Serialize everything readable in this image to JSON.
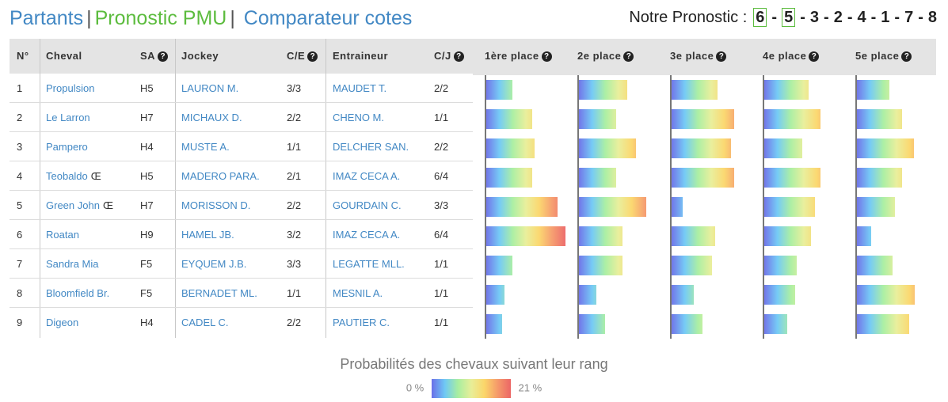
{
  "nav": {
    "partants": "Partants",
    "sep1": "|",
    "pronostic": "Pronostic PMU",
    "sep2": "|",
    "comparateur": "Comparateur cotes"
  },
  "pronostic": {
    "label": "Notre Pronostic :",
    "sequence": [
      "6",
      "5",
      "3",
      "2",
      "4",
      "1",
      "7",
      "8"
    ],
    "highlighted": [
      "6",
      "5"
    ],
    "separator": "-"
  },
  "table": {
    "headers": {
      "num": "N°",
      "cheval": "Cheval",
      "sa": "SA",
      "jockey": "Jockey",
      "ce": "C/E",
      "entraineur": "Entraineur",
      "cj": "C/J",
      "help_icon": "question-circle-icon"
    },
    "rows": [
      {
        "num": "1",
        "cheval": "Propulsion",
        "mark": "",
        "sa": "H5",
        "jockey": "LAURON M.",
        "ce": "3/3",
        "entraineur": "MAUDET T.",
        "cj": "2/2"
      },
      {
        "num": "2",
        "cheval": "Le Larron",
        "mark": "",
        "sa": "H7",
        "jockey": "MICHAUX D.",
        "ce": "2/2",
        "entraineur": "CHENO M.",
        "cj": "1/1"
      },
      {
        "num": "3",
        "cheval": "Pampero",
        "mark": "",
        "sa": "H4",
        "jockey": "MUSTE A.",
        "ce": "1/1",
        "entraineur": "DELCHER SAN.",
        "cj": "2/2"
      },
      {
        "num": "4",
        "cheval": "Teobaldo",
        "mark": "Œ",
        "sa": "H5",
        "jockey": "MADERO PARA.",
        "ce": "2/1",
        "entraineur": "IMAZ CECA A.",
        "cj": "6/4"
      },
      {
        "num": "5",
        "cheval": "Green John",
        "mark": "Œ",
        "sa": "H7",
        "jockey": "MORISSON D.",
        "ce": "2/2",
        "entraineur": "GOURDAIN C.",
        "cj": "3/3"
      },
      {
        "num": "6",
        "cheval": "Roatan",
        "mark": "",
        "sa": "H9",
        "jockey": "HAMEL JB.",
        "ce": "3/2",
        "entraineur": "IMAZ CECA A.",
        "cj": "6/4"
      },
      {
        "num": "7",
        "cheval": "Sandra Mia",
        "mark": "",
        "sa": "F5",
        "jockey": "EYQUEM J.B.",
        "ce": "3/3",
        "entraineur": "LEGATTE MLL.",
        "cj": "1/1"
      },
      {
        "num": "8",
        "cheval": "Bloomfield Br.",
        "mark": "",
        "sa": "F5",
        "jockey": "BERNADET ML.",
        "ce": "1/1",
        "entraineur": "MESNIL A.",
        "cj": "1/1"
      },
      {
        "num": "9",
        "cheval": "Digeon",
        "mark": "",
        "sa": "H4",
        "jockey": "CADEL C.",
        "ce": "2/2",
        "entraineur": "PAUTIER C.",
        "cj": "1/1"
      }
    ]
  },
  "chart_data": {
    "type": "bar",
    "title": "Probabilités des chevaux suivant leur rang",
    "categories": [
      "1",
      "2",
      "3",
      "4",
      "5",
      "6",
      "7",
      "8",
      "9"
    ],
    "unit": "%",
    "scale_min": 0,
    "scale_max": 21,
    "legend_min_label": "0 %",
    "legend_max_label": "21 %",
    "gradient_colors": [
      "#6a6fe8",
      "#6fc8f5",
      "#a8eea0",
      "#e8ee98",
      "#fbd66a",
      "#f59a6a",
      "#ec6666"
    ],
    "series": [
      {
        "name": "1ère place",
        "values": [
          6.9,
          12.2,
          12.8,
          12.2,
          18.9,
          21.0,
          6.9,
          4.8,
          4.2
        ]
      },
      {
        "name": "2e place",
        "values": [
          12.8,
          9.9,
          15.1,
          9.9,
          17.9,
          11.6,
          11.6,
          4.6,
          6.9
        ]
      },
      {
        "name": "3e place",
        "values": [
          12.2,
          16.6,
          15.8,
          16.6,
          2.9,
          11.6,
          10.7,
          5.9,
          8.2
        ]
      },
      {
        "name": "4e place",
        "values": [
          11.8,
          14.9,
          10.1,
          14.9,
          13.4,
          12.4,
          8.6,
          8.2,
          6.1
        ]
      },
      {
        "name": "5e place",
        "values": [
          8.6,
          12.0,
          15.1,
          12.0,
          10.1,
          3.8,
          9.5,
          15.3,
          13.9
        ]
      }
    ]
  }
}
